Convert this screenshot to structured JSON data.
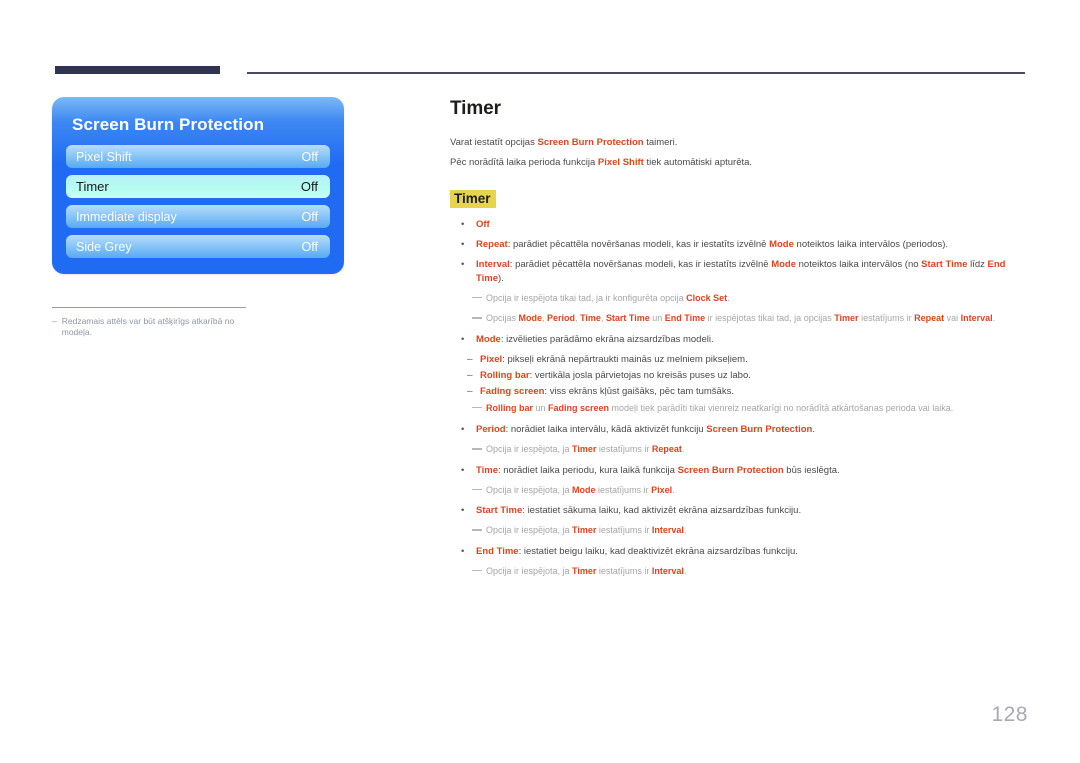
{
  "page": {
    "number": "128"
  },
  "osd": {
    "title": "Screen Burn Protection",
    "rows": [
      {
        "label": "Pixel Shift",
        "value": "Off",
        "selected": false
      },
      {
        "label": "Timer",
        "value": "Off",
        "selected": true
      },
      {
        "label": "Immediate display",
        "value": "Off",
        "selected": false
      },
      {
        "label": "Side Grey",
        "value": "Off",
        "selected": false
      }
    ],
    "footnote_dash": "–",
    "footnote": "Redzamais attēls var būt atšķirīgs atkarībā no modeļa."
  },
  "content": {
    "title": "Timer",
    "intro": [
      {
        "pre": "Varat iestatīt opcijas ",
        "red": "Screen Burn Protection",
        "post": " taimeri."
      },
      {
        "pre": "Pēc norādītā laika perioda funkcija ",
        "red": "Pixel Shift",
        "post": " tiek automātiski apturēta."
      }
    ],
    "section_heading": "Timer",
    "bullet_marker": "•",
    "dash_marker": "–",
    "items": {
      "off": "Off",
      "repeat_label": "Repeat",
      "repeat_a": ": parādiet pēcattēla novēršanas modeli, kas ir iestatīts izvēlnē ",
      "repeat_mode": "Mode",
      "repeat_b": " noteiktos laika intervālos (periodos).",
      "interval_label": "Interval",
      "interval_a": ": parādiet pēcattēla novēršanas modeli, kas ir iestatīts izvēlnē ",
      "interval_mode": "Mode",
      "interval_b": " noteiktos laika intervālos (no ",
      "interval_start": "Start Time",
      "interval_c": " līdz ",
      "interval_end": "End Time",
      "interval_d": ").",
      "note_clock_a": "Opcija ir iespējota tikai tad, ja ir konfigurēta opcija ",
      "note_clock_b": "Clock Set",
      "note_clock_c": ".",
      "note_opts_a": "Opcijas ",
      "note_opts_mode": "Mode",
      "note_opts_s1": ", ",
      "note_opts_period": "Period",
      "note_opts_s2": ", ",
      "note_opts_time": "Time",
      "note_opts_s3": ", ",
      "note_opts_start": "Start Time",
      "note_opts_s4": " un ",
      "note_opts_end": "End Time",
      "note_opts_b": " ir iespējotas tikai tad, ja opcijas ",
      "note_opts_timer": "Timer",
      "note_opts_c": " iestatījums ir ",
      "note_opts_repeat": "Repeat",
      "note_opts_d": " vai ",
      "note_opts_interval": "Interval",
      "note_opts_e": ".",
      "mode_label": "Mode",
      "mode_text": ": izvēlieties parādāmo ekrāna aizsardzības modeli.",
      "pixel_label": "Pixel",
      "pixel_text": ": pikseļi ekrānā nepārtraukti mainās uz melniem pikseļiem.",
      "rolling_label": "Rolling bar",
      "rolling_text": ": vertikāla josla pārvietojas no kreisās puses uz labo.",
      "fading_label": "Fading screen",
      "fading_text": ": viss ekrāns kļūst gaišāks, pēc tam tumšāks.",
      "note_rf_a": "Rolling bar",
      "note_rf_b": " un ",
      "note_rf_c": "Fading screen",
      "note_rf_d": " modeļi tiek parādīti tikai vienreiz neatkarīgi no norādītā atkārtošanas perioda vai laika.",
      "period_label": "Period",
      "period_a": ": norādiet laika intervālu, kādā aktivizēt funkciju ",
      "period_sbp": "Screen Burn Protection",
      "period_b": ".",
      "note_period_a": "Opcija ir iespējota, ja ",
      "note_period_timer": "Timer",
      "note_period_b": " iestatījums ir ",
      "note_period_repeat": "Repeat",
      "note_period_c": ".",
      "time_label": "Time",
      "time_a": ": norādiet laika periodu, kura laikā funkcija ",
      "time_sbp": "Screen Burn Protection",
      "time_b": " būs ieslēgta.",
      "note_time_a": "Opcija ir iespējota, ja ",
      "note_time_mode": "Mode",
      "note_time_b": " iestatījums ir ",
      "note_time_pixel": "Pixel",
      "note_time_c": ".",
      "start_label": "Start Time",
      "start_text": ": iestatiet sākuma laiku, kad aktivizēt ekrāna aizsardzības funkciju.",
      "note_start_a": "Opcija ir iespējota, ja ",
      "note_start_timer": "Timer",
      "note_start_b": " iestatījums ir ",
      "note_start_interval": "Interval",
      "note_start_c": ".",
      "end_label": "End Time",
      "end_text": ": iestatiet beigu laiku, kad deaktivizēt ekrāna aizsardzības funkciju.",
      "note_end_a": "Opcija ir iespējota, ja ",
      "note_end_timer": "Timer",
      "note_end_b": " iestatījums ir ",
      "note_end_interval": "Interval",
      "note_end_c": "."
    }
  },
  "colors": {
    "accent_red": "#e2431c",
    "highlight_yellow": "#e6d44f",
    "osd_blue": "#1f6cf3",
    "osd_selected": "#b4fbf0",
    "rule_dark": "#313353"
  }
}
